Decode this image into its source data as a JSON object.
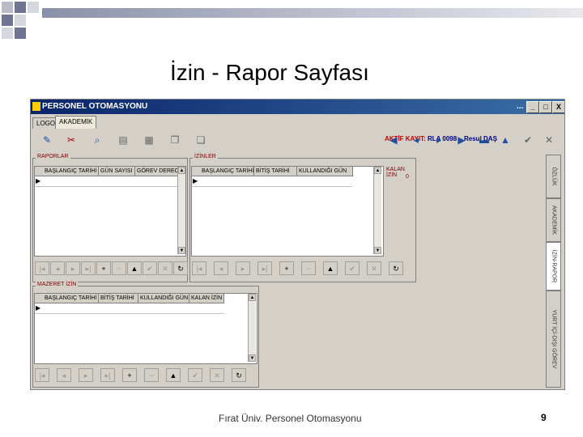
{
  "slide": {
    "title": "İzin - Rapor Sayfası",
    "footer": "Fırat Üniv. Personel Otomasyonu",
    "page_number": "9"
  },
  "window": {
    "title": "PERSONEL OTOMASYONU",
    "dots": "...",
    "minimize": "_",
    "maximize": "□",
    "close": "X"
  },
  "tabs": [
    {
      "label": "LOGO",
      "active": false
    },
    {
      "label": "AKADEMİK",
      "active": true
    }
  ],
  "header_info": {
    "aktif_label": "AKTİF KAYIT:",
    "aktif_value": "RLA 0098",
    "person": "Resul DAŞ"
  },
  "raporlar": {
    "title": "RAPORLAR",
    "columns": [
      "BAŞLANGIÇ TARİHİ",
      "GÜN SAYISI",
      "GÖREV DERECE"
    ]
  },
  "izinler": {
    "title": "İZİNLER",
    "columns": [
      "BAŞLANGIÇ TARİHİ",
      "BİTİŞ TARİHİ",
      "KULLANDIĞI GÜN"
    ],
    "kalan_label": "KALAN İZİN",
    "kalan_value": "0"
  },
  "mazeret": {
    "title": "MAZERET İZİN",
    "columns": [
      "BAŞLANGIÇ TARİHİ",
      "BİTİŞ TARİHİ",
      "KULLANDIĞI GÜN",
      "KALAN İZİN"
    ]
  },
  "vertical_tabs": [
    "ÖZLÜK",
    "AKADEMİK",
    "İZİN-RAPOR",
    "YURT İÇİ-DIŞI GÖREV"
  ],
  "icons": {
    "toolbar": [
      "tool-icon",
      "wrench-icon",
      "search-icon",
      "document-icon",
      "print-icon",
      "copy-icon",
      "paste-icon"
    ],
    "nav": [
      "first-icon",
      "prev-icon",
      "next-icon",
      "last-icon",
      "add-icon",
      "delete-icon",
      "up-icon",
      "check-icon",
      "cancel-icon",
      "refresh-icon"
    ]
  }
}
